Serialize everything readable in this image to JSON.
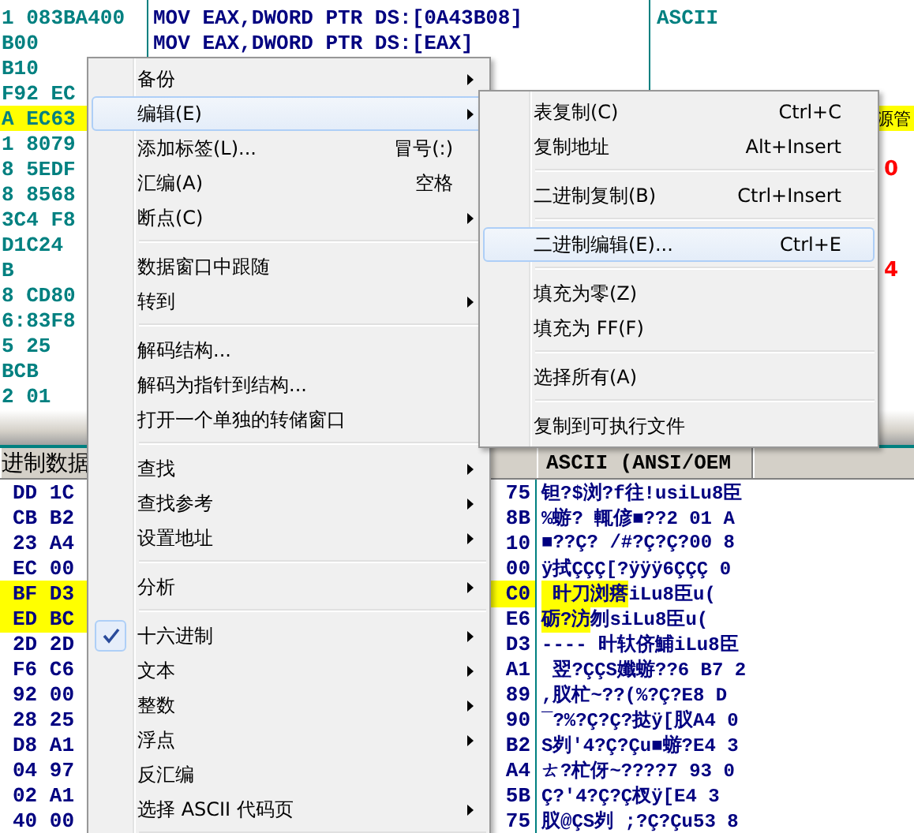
{
  "code_pane": {
    "rows": [
      {
        "bytes": "1 083BA400",
        "disasm": "MOV EAX,DWORD PTR DS:[0A43B08]",
        "comment": "ASCII",
        "tail": "",
        "selected": false
      },
      {
        "bytes": "B00",
        "disasm": "MOV EAX,DWORD PTR DS:[EAX]",
        "comment": "",
        "tail": "",
        "selected": false
      },
      {
        "bytes": "B10",
        "disasm": "",
        "comment": "",
        "tail": "",
        "selected": false
      },
      {
        "bytes": "F92 EC",
        "disasm": "",
        "comment": "",
        "tail": "",
        "selected": false
      },
      {
        "bytes": "A EC63",
        "disasm": "",
        "comment": "",
        "tail": "源管",
        "selected": true
      },
      {
        "bytes": "1 8079",
        "disasm": "",
        "comment": "",
        "tail": "",
        "selected": false
      },
      {
        "bytes": "8 5EDF",
        "disasm": "",
        "comment": "",
        "tail": "0",
        "selected": false
      },
      {
        "bytes": "8 8568",
        "disasm": "",
        "comment": "",
        "tail": "",
        "selected": false
      },
      {
        "bytes": "3C4 F8",
        "disasm": "",
        "comment": "",
        "tail": "",
        "selected": false
      },
      {
        "bytes": "D1C24",
        "disasm": "",
        "comment": "",
        "tail": "",
        "selected": false
      },
      {
        "bytes": "B",
        "disasm": "",
        "comment": "",
        "tail": "4",
        "selected": false
      },
      {
        "bytes": "8 CD80",
        "disasm": "",
        "comment": "",
        "tail": "",
        "selected": false
      },
      {
        "bytes": "6:83F8",
        "disasm": "",
        "comment": "",
        "tail": "",
        "selected": false
      },
      {
        "bytes": "5 25",
        "disasm": "",
        "comment": "",
        "tail": "",
        "selected": false
      },
      {
        "bytes": "BCB",
        "disasm": "",
        "comment": "",
        "tail": "",
        "selected": false
      },
      {
        "bytes": "2 01",
        "disasm": "",
        "comment": "",
        "tail": "",
        "selected": false
      }
    ]
  },
  "dump_pane": {
    "columns": [
      "进制数据",
      "ASCII (ANSI/OEM"
    ],
    "rows": [
      {
        "hex": "DD 1C",
        "hex_selected": false,
        "last_byte": "75",
        "last_selected": false,
        "ascii": "钽?$浏?f往!usiLu8臣"
      },
      {
        "hex": "CB B2",
        "hex_selected": false,
        "last_byte": "8B",
        "last_selected": false,
        "ascii": "%蝣? 輒偐■??2 01 A"
      },
      {
        "hex": "23 A4",
        "hex_selected": false,
        "last_byte": "10",
        "last_selected": false,
        "ascii": "■??Ç? /#?Ç?Ç?00 8"
      },
      {
        "hex": "EC 00",
        "hex_selected": false,
        "last_byte": "00",
        "last_selected": false,
        "ascii": "ÿ拭ÇÇÇ[?ÿÿÿ6ÇÇÇ 0"
      },
      {
        "hex": "BF D3",
        "hex_selected": true,
        "last_byte": "C0",
        "last_selected": true,
        "ascii_marked": " 旪刀浏瘩",
        "ascii": "iLu8臣u("
      },
      {
        "hex": "ED BC",
        "hex_selected": true,
        "last_byte": "E6",
        "last_selected": false,
        "ascii_marked": "砺?汸",
        "ascii": "刎siLu8臣u("
      },
      {
        "hex": "2D 2D",
        "hex_selected": false,
        "last_byte": "D3",
        "last_selected": false,
        "ascii": "---- 旪轪侪鯆iLu8臣"
      },
      {
        "hex": "F6 C6",
        "hex_selected": false,
        "last_byte": "A1",
        "last_selected": false,
        "ascii": " 翌?ÇÇS孅蝣??6 B7 2"
      },
      {
        "hex": "92 00",
        "hex_selected": false,
        "last_byte": "89",
        "last_selected": false,
        "ascii": ",肞杧~??(%?Ç?E8 D"
      },
      {
        "hex": "28 25",
        "hex_selected": false,
        "last_byte": "90",
        "last_selected": false,
        "ascii": "¯?%?Ç?Ç?挞ÿ[肞A4 0"
      },
      {
        "hex": "D8 A1",
        "hex_selected": false,
        "last_byte": "B2",
        "last_selected": false,
        "ascii": "S刿′4?Ç?Çu■蝣?E4 3"
      },
      {
        "hex": "04 97",
        "hex_selected": false,
        "last_byte": "A4",
        "last_selected": false,
        "ascii": "ㄊ?杧伢~????7 93 0"
      },
      {
        "hex": "02 A1",
        "hex_selected": false,
        "last_byte": "5B",
        "last_selected": false,
        "ascii": "Ç?′4?Ç?Ç杈ÿ[E4 3"
      },
      {
        "hex": "40 00",
        "hex_selected": false,
        "last_byte": "75",
        "last_selected": false,
        "ascii": "肞@ÇS刿 ;?Ç?Çu53 8"
      }
    ]
  },
  "context_menu": {
    "items": [
      {
        "kind": "item",
        "label": "备份",
        "submenu": true,
        "selected": false,
        "checked": false
      },
      {
        "kind": "item",
        "label": "编辑(E)",
        "submenu": true,
        "selected": true,
        "checked": false
      },
      {
        "kind": "item",
        "label": "添加标签(L)...",
        "shortcut": "冒号(:)",
        "submenu": false,
        "selected": false,
        "checked": false
      },
      {
        "kind": "item",
        "label": "汇编(A)",
        "shortcut": "空格",
        "submenu": false,
        "selected": false,
        "checked": false
      },
      {
        "kind": "item",
        "label": "断点(C)",
        "submenu": true,
        "selected": false,
        "checked": false
      },
      {
        "kind": "separator"
      },
      {
        "kind": "item",
        "label": "数据窗口中跟随",
        "submenu": false,
        "selected": false,
        "checked": false
      },
      {
        "kind": "item",
        "label": "转到",
        "submenu": true,
        "selected": false,
        "checked": false
      },
      {
        "kind": "separator"
      },
      {
        "kind": "item",
        "label": "解码结构...",
        "submenu": false,
        "selected": false,
        "checked": false
      },
      {
        "kind": "item",
        "label": "解码为指针到结构...",
        "submenu": false,
        "selected": false,
        "checked": false
      },
      {
        "kind": "item",
        "label": "打开一个单独的转储窗口",
        "submenu": false,
        "selected": false,
        "checked": false
      },
      {
        "kind": "separator"
      },
      {
        "kind": "item",
        "label": "查找",
        "submenu": true,
        "selected": false,
        "checked": false
      },
      {
        "kind": "item",
        "label": "查找参考",
        "submenu": true,
        "selected": false,
        "checked": false
      },
      {
        "kind": "item",
        "label": "设置地址",
        "submenu": true,
        "selected": false,
        "checked": false
      },
      {
        "kind": "separator"
      },
      {
        "kind": "item",
        "label": "分析",
        "submenu": true,
        "selected": false,
        "checked": false
      },
      {
        "kind": "separator"
      },
      {
        "kind": "item",
        "label": "十六进制",
        "submenu": true,
        "selected": false,
        "checked": true
      },
      {
        "kind": "item",
        "label": "文本",
        "submenu": true,
        "selected": false,
        "checked": false
      },
      {
        "kind": "item",
        "label": "整数",
        "submenu": true,
        "selected": false,
        "checked": false
      },
      {
        "kind": "item",
        "label": "浮点",
        "submenu": true,
        "selected": false,
        "checked": false
      },
      {
        "kind": "item",
        "label": "反汇编",
        "submenu": false,
        "selected": false,
        "checked": false
      },
      {
        "kind": "item",
        "label": "选择 ASCII 代码页",
        "submenu": true,
        "selected": false,
        "checked": false
      },
      {
        "kind": "separator"
      }
    ]
  },
  "edit_submenu": {
    "items": [
      {
        "kind": "item",
        "label": "表复制(C)",
        "shortcut": "Ctrl+C",
        "selected": false
      },
      {
        "kind": "item",
        "label": "复制地址",
        "shortcut": "Alt+Insert",
        "selected": false
      },
      {
        "kind": "separator"
      },
      {
        "kind": "item",
        "label": "二进制复制(B)",
        "shortcut": "Ctrl+Insert",
        "selected": false
      },
      {
        "kind": "separator"
      },
      {
        "kind": "item",
        "label": "二进制编辑(E)...",
        "shortcut": "Ctrl+E",
        "selected": true
      },
      {
        "kind": "separator"
      },
      {
        "kind": "item",
        "label": "填充为零(Z)",
        "selected": false
      },
      {
        "kind": "item",
        "label": "填充为 FF(F)",
        "selected": false
      },
      {
        "kind": "separator"
      },
      {
        "kind": "item",
        "label": "选择所有(A)",
        "selected": false
      },
      {
        "kind": "separator"
      },
      {
        "kind": "item",
        "label": "复制到可执行文件",
        "selected": false
      }
    ]
  }
}
